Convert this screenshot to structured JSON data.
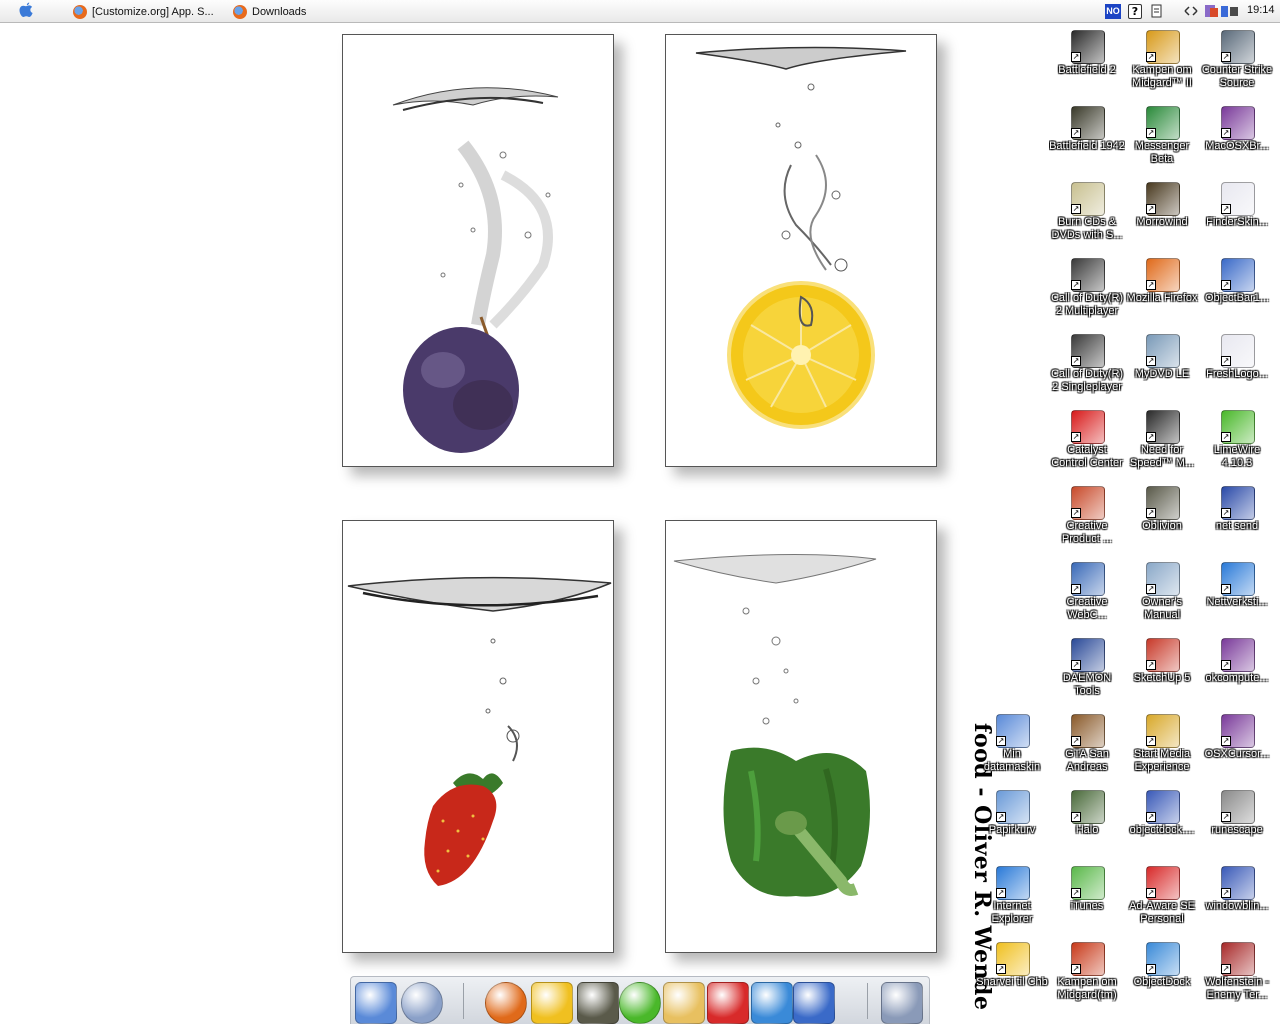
{
  "menubar": {
    "tasks": [
      {
        "label": "[Customize.org] App. S..."
      },
      {
        "label": "Downloads"
      }
    ],
    "tray": {
      "language": "NO",
      "help": "?"
    },
    "clock": "19:14"
  },
  "wallpaper": {
    "caption": "food - Oliver R. Wende",
    "photos": [
      "plum",
      "lemon",
      "strawberry",
      "green-pepper"
    ]
  },
  "desktop_icons": [
    {
      "label": "Battlefield 2",
      "icon": "battlefield2-icon",
      "color": "#2b2b2b"
    },
    {
      "label": "Kampen om Midgard™ II",
      "icon": "kampen-om-midgard-icon",
      "color": "#d89a1a"
    },
    {
      "label": "Counter Strike Source",
      "icon": "counter-strike-icon",
      "color": "#5a6a7a"
    },
    {
      "label": "Battlefield 1942",
      "icon": "battlefield1942-icon",
      "color": "#3a3a2a"
    },
    {
      "label": "Messenger Beta",
      "icon": "messenger-icon",
      "color": "#2a8a3a"
    },
    {
      "label": "MacOSXBr...",
      "icon": "winrar-archive-icon",
      "color": "#7a3a9a"
    },
    {
      "label": "Burn CDs & DVDs with S...",
      "icon": "cd-burn-icon",
      "color": "#c8c090"
    },
    {
      "label": "Morrowind",
      "icon": "morrowind-icon",
      "color": "#4a3a20"
    },
    {
      "label": "FinderSkin...",
      "icon": "text-file-icon",
      "color": "#e8e8f0"
    },
    {
      "label": "Call of Duty(R) 2 Multiplayer",
      "icon": "call-of-duty-icon",
      "color": "#3a3a3a"
    },
    {
      "label": "Mozilla Firefox",
      "icon": "firefox-icon",
      "color": "#e06a1a"
    },
    {
      "label": "ObjectBar1...",
      "icon": "objectbar-icon",
      "color": "#3a6ac8"
    },
    {
      "label": "Call of Duty(R) 2 Singleplayer",
      "icon": "call-of-duty-icon",
      "color": "#3a3a3a"
    },
    {
      "label": "MyDVD LE",
      "icon": "dvd-icon",
      "color": "#7a9ab8"
    },
    {
      "label": "FreshLogo...",
      "icon": "text-file-icon",
      "color": "#e8e8f0"
    },
    {
      "label": "Catalyst Control Center",
      "icon": "ati-icon",
      "color": "#d81a1a"
    },
    {
      "label": "Need for Speed™ M...",
      "icon": "need-for-speed-icon",
      "color": "#2a2a2a"
    },
    {
      "label": "LimeWire 4.10.3",
      "icon": "limewire-icon",
      "color": "#4ab82a"
    },
    {
      "label": "Creative Product ...",
      "icon": "creative-product-icon",
      "color": "#c84a2a"
    },
    {
      "label": "Oblivion",
      "icon": "oblivion-icon",
      "color": "#5a5a4a"
    },
    {
      "label": "net send",
      "icon": "net-send-icon",
      "color": "#2a4aa8"
    },
    {
      "label": "Creative WebC...",
      "icon": "webcam-icon",
      "color": "#3a6ab8"
    },
    {
      "label": "Owner's Manual",
      "icon": "manual-icon",
      "color": "#8aa8c8"
    },
    {
      "label": "Nettverksti...",
      "icon": "network-icon",
      "color": "#2a7ad8"
    },
    {
      "label": "DAEMON Tools",
      "icon": "daemon-tools-icon",
      "color": "#2a4a98"
    },
    {
      "label": "SketchUp 5",
      "icon": "sketchup-icon",
      "color": "#c83a2a"
    },
    {
      "label": "okcompute...",
      "icon": "winrar-archive-icon",
      "color": "#7a3a9a"
    },
    {
      "label": "Min datamaskin",
      "icon": "my-computer-icon",
      "color": "#5a8ad8"
    },
    {
      "label": "GTA San Andreas",
      "icon": "gta-icon",
      "color": "#8a5a2a"
    },
    {
      "label": "Start Media Experience",
      "icon": "media-experience-icon",
      "color": "#d8a82a"
    },
    {
      "label": "OSXCursor...",
      "icon": "winrar-archive-icon",
      "color": "#7a3a9a"
    },
    {
      "label": "Papirkurv",
      "icon": "recycle-bin-icon",
      "color": "#6a9ad8"
    },
    {
      "label": "Halo",
      "icon": "halo-icon",
      "color": "#4a6a3a"
    },
    {
      "label": "objectdock....",
      "icon": "installer-icon",
      "color": "#3a5ab8"
    },
    {
      "label": "runescape",
      "icon": "sword-icon",
      "color": "#8a8a8a"
    },
    {
      "label": "Internet Explorer",
      "icon": "internet-explorer-icon",
      "color": "#2a7ad8"
    },
    {
      "label": "iTunes",
      "icon": "itunes-icon",
      "color": "#5ab84a"
    },
    {
      "label": "Ad-Aware SE Personal",
      "icon": "ad-aware-icon",
      "color": "#d82a2a"
    },
    {
      "label": "windowblin...",
      "icon": "installer-icon",
      "color": "#3a5ab8"
    },
    {
      "label": "Snarvei til Chb",
      "icon": "star-icon",
      "color": "#f0c020"
    },
    {
      "label": "Kampen om Midgard(tm)",
      "icon": "kampen-om-midgard-icon",
      "color": "#c83a1a"
    },
    {
      "label": "ObjectDock",
      "icon": "objectdock-icon",
      "color": "#3a8ad8"
    },
    {
      "label": "Wolfenstein - Enemy Ter...",
      "icon": "wolfenstein-icon",
      "color": "#a82a2a"
    }
  ],
  "dock": {
    "items": [
      {
        "icon": "my-computer-icon",
        "color": "#5a8ad8"
      },
      {
        "icon": "clock-icon",
        "color": "#8aa0c8"
      },
      {
        "icon": "firefox-icon",
        "color": "#e06a1a"
      },
      {
        "icon": "star-icon",
        "color": "#f0c020"
      },
      {
        "icon": "oblivion-icon",
        "color": "#5a5a4a"
      },
      {
        "icon": "limewire-icon",
        "color": "#4ab82a"
      },
      {
        "icon": "folder-icon",
        "color": "#e8c060"
      },
      {
        "icon": "ad-aware-icon",
        "color": "#d82a2a"
      },
      {
        "icon": "network-tools-icon",
        "color": "#3a8ad8"
      },
      {
        "icon": "objectdock-icon",
        "color": "#3a6ac8"
      },
      {
        "icon": "trash-icon",
        "color": "#8a9ab8"
      }
    ]
  }
}
